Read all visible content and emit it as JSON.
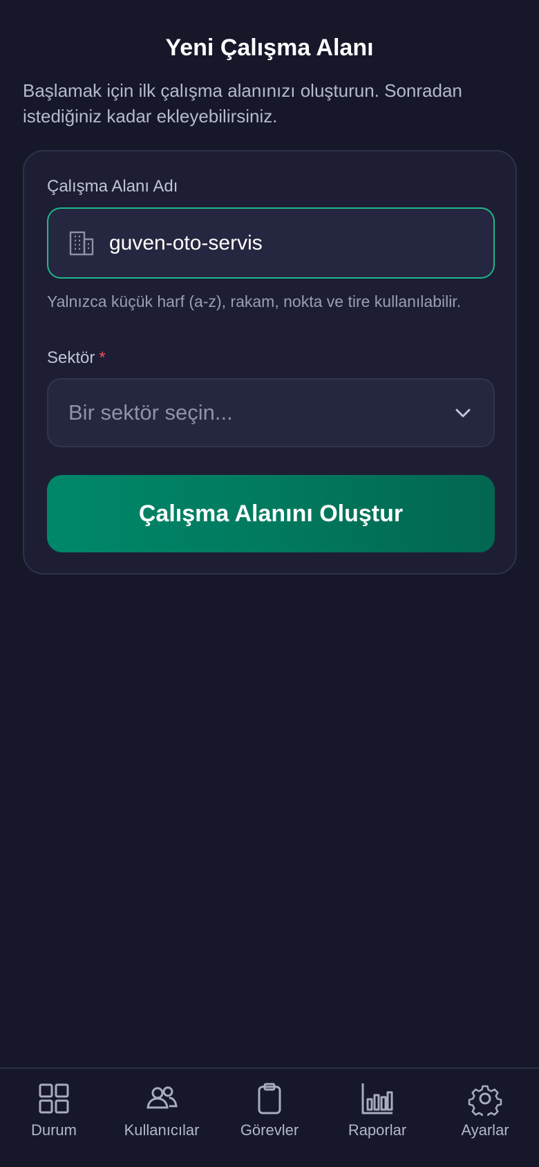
{
  "header": {
    "title": "Yeni Çalışma Alanı",
    "subtitle": "Başlamak için ilk çalışma alanınızı oluşturun. Sonradan istediğiniz kadar ekleyebilirsiniz."
  },
  "form": {
    "name_label": "Çalışma Alanı Adı",
    "name_value": "guven-oto-servis",
    "name_icon": "building-icon",
    "name_hint": "Yalnızca küçük harf (a-z), rakam, nokta ve tire kullanılabilir.",
    "sector_label": "Sektör",
    "sector_required_mark": "*",
    "sector_placeholder": "Bir sektör seçin...",
    "sector_icon": "chevron-down-icon",
    "submit_label": "Çalışma Alanını Oluştur"
  },
  "tabbar": {
    "items": [
      {
        "label": "Durum",
        "icon": "grid-icon"
      },
      {
        "label": "Kullanıcılar",
        "icon": "users-icon"
      },
      {
        "label": "Görevler",
        "icon": "clipboard-icon"
      },
      {
        "label": "Raporlar",
        "icon": "bar-chart-icon"
      },
      {
        "label": "Ayarlar",
        "icon": "gear-icon"
      }
    ]
  },
  "colors": {
    "background": "#161729",
    "card": "#1d1e33",
    "accent": "#1fb88b",
    "button": "#00876a",
    "required": "#ef4d5b"
  }
}
